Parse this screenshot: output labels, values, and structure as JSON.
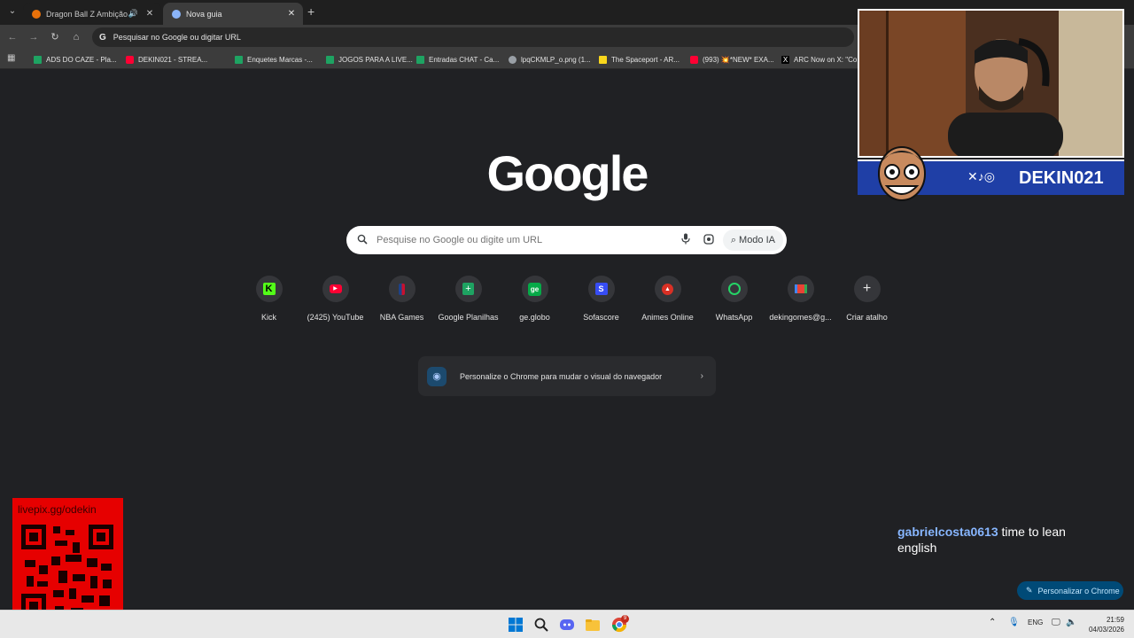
{
  "tabs": [
    {
      "title": "Dragon Ball Z Ambição de ",
      "active": false,
      "audio": true
    },
    {
      "title": "Nova guia",
      "active": true,
      "audio": false
    }
  ],
  "omnibox": {
    "placeholder": "Pesquisar no Google ou digitar URL"
  },
  "bookmarks": [
    {
      "label": "ADS DO CAZE - Pla...",
      "icon": "sheets-icon"
    },
    {
      "label": "DEKIN021 - STREA...",
      "icon": "youtube-icon"
    },
    {
      "label": "Enquetes Marcas -...",
      "icon": "sheets-icon"
    },
    {
      "label": "JOGOS PARA A LIVE...",
      "icon": "sheets-icon"
    },
    {
      "label": "Entradas CHAT - Ca...",
      "icon": "sheets-icon"
    },
    {
      "label": "lpqCKMLP_o.png (1...",
      "icon": "globe-icon"
    },
    {
      "label": "The Spaceport - AR...",
      "icon": "spaceport-icon"
    },
    {
      "label": "(993) 💥*NEW* EXA...",
      "icon": "youtube-icon"
    },
    {
      "label": "ARC Now on X: \"Co...",
      "icon": "x-icon"
    }
  ],
  "logo": "Google",
  "search": {
    "placeholder": "Pesquise no Google ou digite um URL",
    "ai_label": "Modo IA"
  },
  "shortcuts": [
    {
      "label": "Kick",
      "icon": "kick-icon"
    },
    {
      "label": "(2425) YouTube",
      "icon": "youtube-icon"
    },
    {
      "label": "NBA Games",
      "icon": "nba-icon"
    },
    {
      "label": "Google Planilhas",
      "icon": "sheets-icon"
    },
    {
      "label": "ge.globo",
      "icon": "ge-icon"
    },
    {
      "label": "Sofascore",
      "icon": "sofascore-icon"
    },
    {
      "label": "Animes Online",
      "icon": "animes-icon"
    },
    {
      "label": "WhatsApp",
      "icon": "whatsapp-icon"
    },
    {
      "label": "dekingomes@g...",
      "icon": "gmail-icon"
    },
    {
      "label": "Criar atalho",
      "icon": "plus-icon"
    }
  ],
  "customize_bar": {
    "text": "Personalize o Chrome para mudar o visual do navegador"
  },
  "overlay": {
    "handle": "DEKIN021",
    "qr_url": "livepix.gg/odekin",
    "chat_user": "gabrielcosta0613",
    "chat_message": "time to lean english"
  },
  "customize_button": "Personalizar o Chrome",
  "taskbar": {
    "lang": "ENG",
    "time": "21:59",
    "date": "04/03/2026",
    "chrome_badge": "9"
  },
  "colors": {
    "background": "#202124",
    "accent": "#004a77",
    "qr_bg": "#e60000"
  }
}
